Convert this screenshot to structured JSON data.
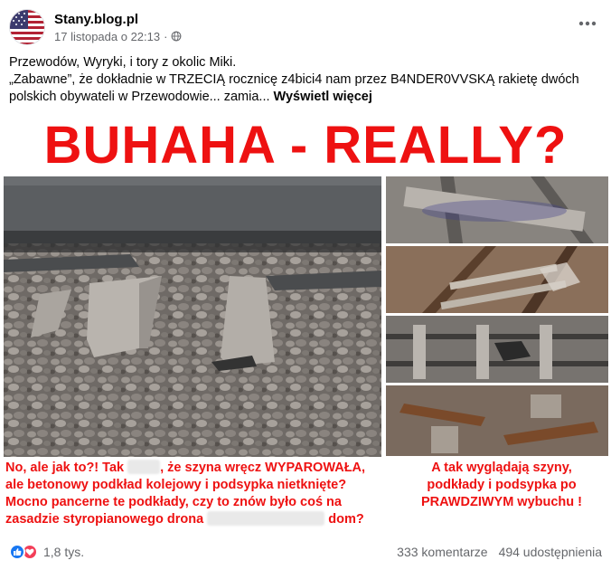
{
  "post": {
    "page_name": "Stany.blog.pl",
    "timestamp": "17 listopada o 22:13",
    "separator": "·",
    "text_line1": "Przewodów, Wyryki, i tory z okolic Miki.",
    "text_line2": "„Zabawne”, że dokładnie w TRZECIĄ rocznicę z4bici4 nam przez B4NDER0VVSKĄ rakietę dwóch polskich obywateli w Przewodowie... zamia...",
    "see_more": "Wyświetl więcej"
  },
  "image": {
    "headline": "BUHAHA - REALLY?",
    "caption_left_1a": "No, ale jak to?! Tak",
    "caption_left_1b": ", że szyna wręcz WYPAROWAŁA,",
    "caption_left_2": "ale betonowy podkład kolejowy i podsypka nietknięte?",
    "caption_left_3": "Mocno pancerne te podkłady, czy to znów było coś na",
    "caption_left_4a": "zasadzie styropianowego drona",
    "caption_left_4b": "dom?",
    "caption_right_1": "A tak wyglądają szyny,",
    "caption_right_2": "podkłady i podsypka po",
    "caption_right_3": "PRAWDZIWYM wybuchu !"
  },
  "footer": {
    "reactions_count": "1,8 tys.",
    "comments": "333 komentarze",
    "shares": "494 udostępnienia"
  },
  "icons": {
    "avatar": "us-flag-avatar",
    "privacy": "globe-icon",
    "more": "more-horizontal-icon",
    "reaction_like": "like-icon",
    "reaction_love": "love-icon"
  },
  "colors": {
    "headline_red": "#ee1111",
    "like_blue": "#1877f2",
    "love_red": "#f33e58",
    "secondary_text": "#65676b"
  }
}
